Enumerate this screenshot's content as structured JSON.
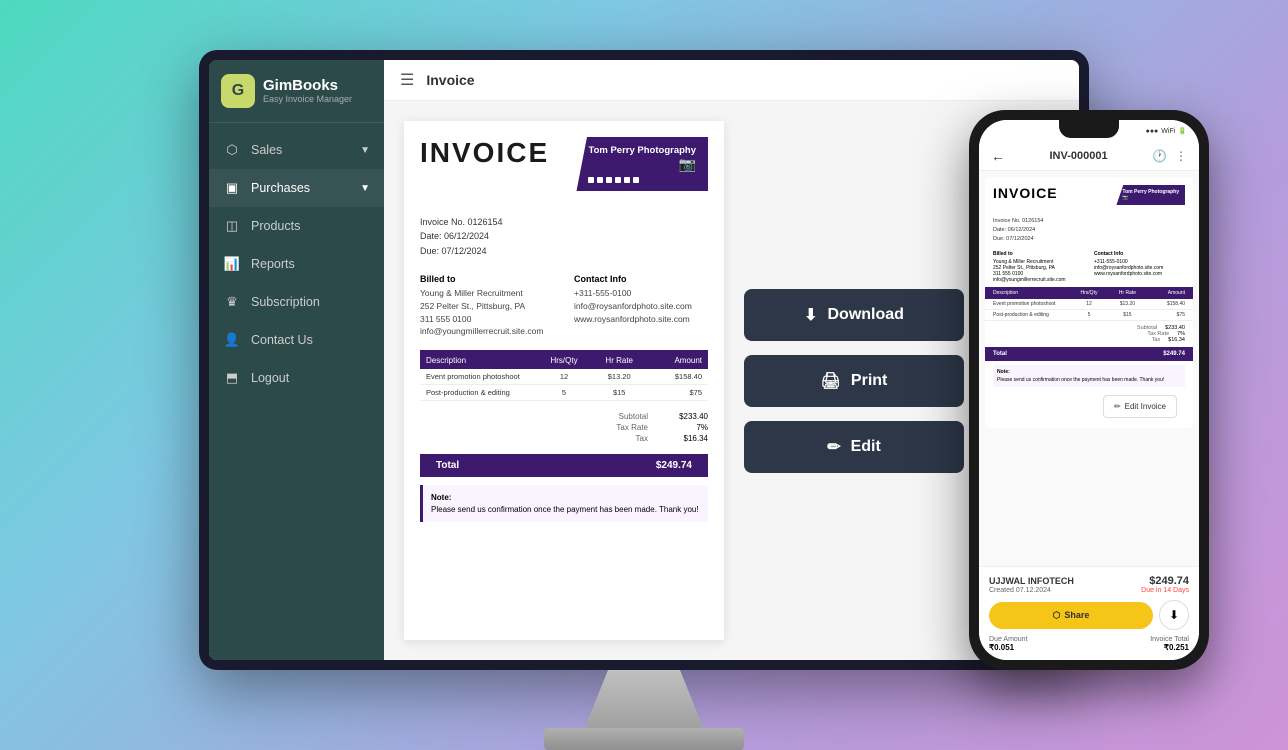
{
  "app": {
    "name": "GimBooks",
    "tagline": "Easy Invoice Manager",
    "page_title": "Invoice"
  },
  "sidebar": {
    "items": [
      {
        "id": "sales",
        "label": "Sales",
        "icon": "↗",
        "has_chevron": true
      },
      {
        "id": "purchases",
        "label": "Purchases",
        "icon": "🛒",
        "has_chevron": true
      },
      {
        "id": "products",
        "label": "Products",
        "icon": "📦",
        "has_chevron": false
      },
      {
        "id": "reports",
        "label": "Reports",
        "icon": "📊",
        "has_chevron": false
      },
      {
        "id": "subscription",
        "label": "Subscription",
        "icon": "👑",
        "has_chevron": false
      },
      {
        "id": "contact-us",
        "label": "Contact Us",
        "icon": "👤",
        "has_chevron": false
      },
      {
        "id": "logout",
        "label": "Logout",
        "icon": "🚪",
        "has_chevron": false
      }
    ]
  },
  "invoice": {
    "title": "INVOICE",
    "company_name": "Tom Perry Photography",
    "number": "Invoice No. 0126154",
    "date": "Date: 06/12/2024",
    "due": "Due: 07/12/2024",
    "billed_to": {
      "label": "Billed to",
      "name": "Young & Miller Recruitment",
      "address": "252 Pelter St., Pittsburg, PA",
      "phone": "311 555 0100",
      "email": "info@youngmillerrecruit.site.com"
    },
    "contact_info": {
      "label": "Contact Info",
      "phone": "+311-555-0100",
      "email": "info@roysanfordphoto.site.com",
      "website": "www.roysanfordphoto.site.com"
    },
    "table": {
      "headers": [
        "Description",
        "Hrs/Qty",
        "Hr Rate",
        "Amount"
      ],
      "rows": [
        {
          "desc": "Event promotion photoshoot",
          "qty": "12",
          "rate": "$13.20",
          "amount": "$158.40"
        },
        {
          "desc": "Post-production & editing",
          "qty": "5",
          "rate": "$15",
          "amount": "$75"
        }
      ]
    },
    "subtotal": "$233.40",
    "tax_rate": "7%",
    "tax": "$16.34",
    "total": "$249.74",
    "note_label": "Note:",
    "note_text": "Please send us confirmation once the payment has been made.\nThank you!"
  },
  "actions": {
    "download": "Download",
    "print": "Print",
    "edit": "Edit"
  },
  "phone": {
    "invoice_number": "INV-000001",
    "company": "UJJWAL INFOTECH",
    "created": "Created  07.12.2024",
    "amount": "$249.74",
    "due_note": "Due in 14 Days",
    "share_label": "Share",
    "due_amount_label": "Due Amount",
    "invoice_total_label": "Invoice Total",
    "due_amount_value": "₹0.051",
    "invoice_total_value": "₹0.251"
  }
}
